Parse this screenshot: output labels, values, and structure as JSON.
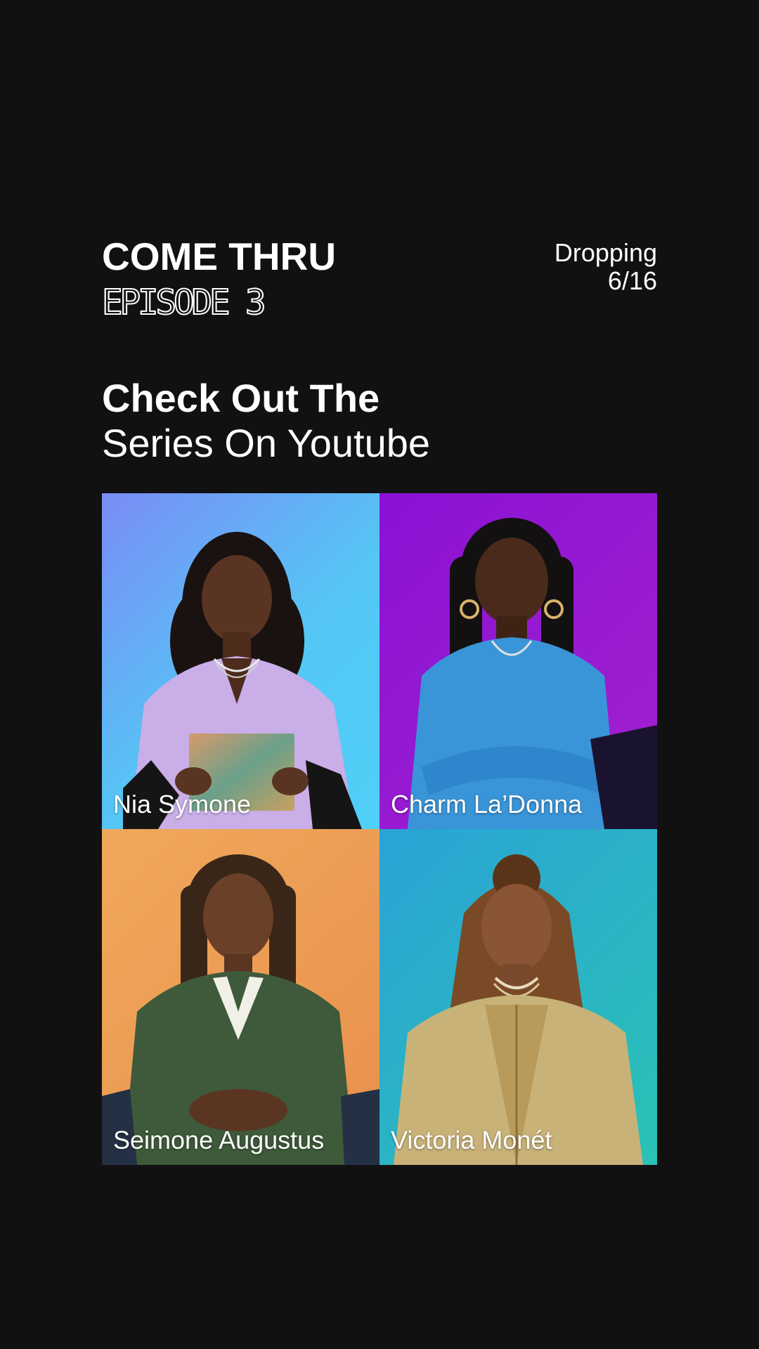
{
  "header": {
    "show_title": "COME THRU",
    "episode": "EPISODE 3",
    "drop_line1": "Dropping",
    "drop_line2": "6/16"
  },
  "cta": {
    "line1": "Check Out The",
    "line2": "Series On Youtube"
  },
  "guests": [
    {
      "name": "Nia Symone",
      "bg": "#55c6f5"
    },
    {
      "name": "Charm La’Donna",
      "bg": "#9a1bd1"
    },
    {
      "name": "Seimone Augustus",
      "bg": "#eb9a52"
    },
    {
      "name": "Victoria Monét",
      "bg": "#2ab4c4"
    }
  ],
  "colors": {
    "background": "#111111",
    "text": "#ffffff"
  }
}
